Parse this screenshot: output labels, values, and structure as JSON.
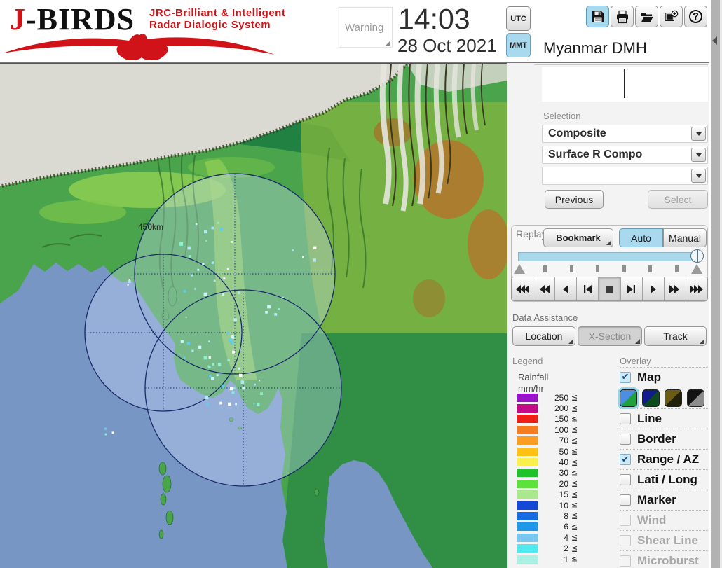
{
  "header": {
    "logo_j": "J",
    "logo_rest": "-BIRDS",
    "tagline_line1": "JRC-Brilliant & Intelligent",
    "tagline_line2": "Radar  Dialogic  System",
    "warning_label": "Warning",
    "clock_time": "14:03",
    "clock_date": "28 Oct 2021",
    "tz_utc": "UTC",
    "tz_mmt": "MMT",
    "mmt_active": true,
    "station_name": "Myanmar DMH",
    "toolbar": [
      {
        "name": "save-icon",
        "active": true
      },
      {
        "name": "print-icon",
        "active": false
      },
      {
        "name": "open-folder-icon",
        "active": false
      },
      {
        "name": "add-image-icon",
        "active": false
      },
      {
        "name": "help-icon",
        "glyph": "?",
        "active": false
      }
    ]
  },
  "selection": {
    "label": "Selection",
    "field1": "Composite",
    "field2": "Surface R Compo",
    "field3": "",
    "previous_label": "Previous",
    "select_label": "Select",
    "select_disabled": true
  },
  "replay": {
    "label": "Replay",
    "bookmark_label": "Bookmark",
    "auto_label": "Auto",
    "manual_label": "Manual",
    "auto_active": true,
    "playback": [
      {
        "name": "rewind-fast",
        "active": false
      },
      {
        "name": "rewind",
        "active": false
      },
      {
        "name": "reverse-play",
        "active": false
      },
      {
        "name": "step-first",
        "active": false
      },
      {
        "name": "stop",
        "active": true
      },
      {
        "name": "step-last",
        "active": false
      },
      {
        "name": "play",
        "active": false
      },
      {
        "name": "forward",
        "active": false
      },
      {
        "name": "forward-fast",
        "active": false
      }
    ]
  },
  "data_assistance": {
    "label": "Data Assistance",
    "location_label": "Location",
    "xsection_label": "X-Section",
    "track_label": "Track",
    "xsection_pressed": true
  },
  "legend": {
    "label": "Legend",
    "title_line1": "Rainfall",
    "title_line2": "mm/hr",
    "unit_symbol": "≦",
    "items": [
      {
        "value": "250",
        "color": "#9b12cd"
      },
      {
        "value": "200",
        "color": "#c40a85"
      },
      {
        "value": "150",
        "color": "#ec2114"
      },
      {
        "value": "100",
        "color": "#f57d20"
      },
      {
        "value": "70",
        "color": "#fb9d23"
      },
      {
        "value": "50",
        "color": "#fcc113"
      },
      {
        "value": "40",
        "color": "#f9f04e"
      },
      {
        "value": "30",
        "color": "#1ec32b"
      },
      {
        "value": "20",
        "color": "#5ce23a"
      },
      {
        "value": "15",
        "color": "#a9e98b"
      },
      {
        "value": "10",
        "color": "#1548d8"
      },
      {
        "value": "8",
        "color": "#176ae2"
      },
      {
        "value": "6",
        "color": "#1f97ea"
      },
      {
        "value": "4",
        "color": "#79c7ee"
      },
      {
        "value": "2",
        "color": "#4fe9ee"
      },
      {
        "value": "1",
        "color": "#aaf1e3"
      }
    ]
  },
  "overlay": {
    "label": "Overlay",
    "items": [
      {
        "label": "Map",
        "checked": true,
        "disabled": false
      },
      {
        "label": "Line",
        "checked": false,
        "disabled": false
      },
      {
        "label": "Border",
        "checked": false,
        "disabled": false
      },
      {
        "label": "Range / AZ",
        "checked": true,
        "disabled": false
      },
      {
        "label": "Lati / Long",
        "checked": false,
        "disabled": false
      },
      {
        "label": "Marker",
        "checked": false,
        "disabled": false
      },
      {
        "label": "Wind",
        "checked": false,
        "disabled": true
      },
      {
        "label": "Shear Line",
        "checked": false,
        "disabled": true
      },
      {
        "label": "Microburst",
        "checked": false,
        "disabled": true
      }
    ],
    "map_styles": [
      {
        "top": "#4b8fe2",
        "bottom": "#1fa13e",
        "selected": true
      },
      {
        "top": "#121b8e",
        "bottom": "#0d4a20",
        "selected": false
      },
      {
        "top": "#6b5c14",
        "bottom": "#23200a",
        "selected": false
      },
      {
        "top": "#131313",
        "bottom": "#8d8d8d",
        "selected": false
      }
    ]
  },
  "map": {
    "range_label": "450km",
    "sea_color": "#7796c4",
    "coverage_color": "#cfe0ff",
    "ring_color": "#1b2a6a"
  }
}
